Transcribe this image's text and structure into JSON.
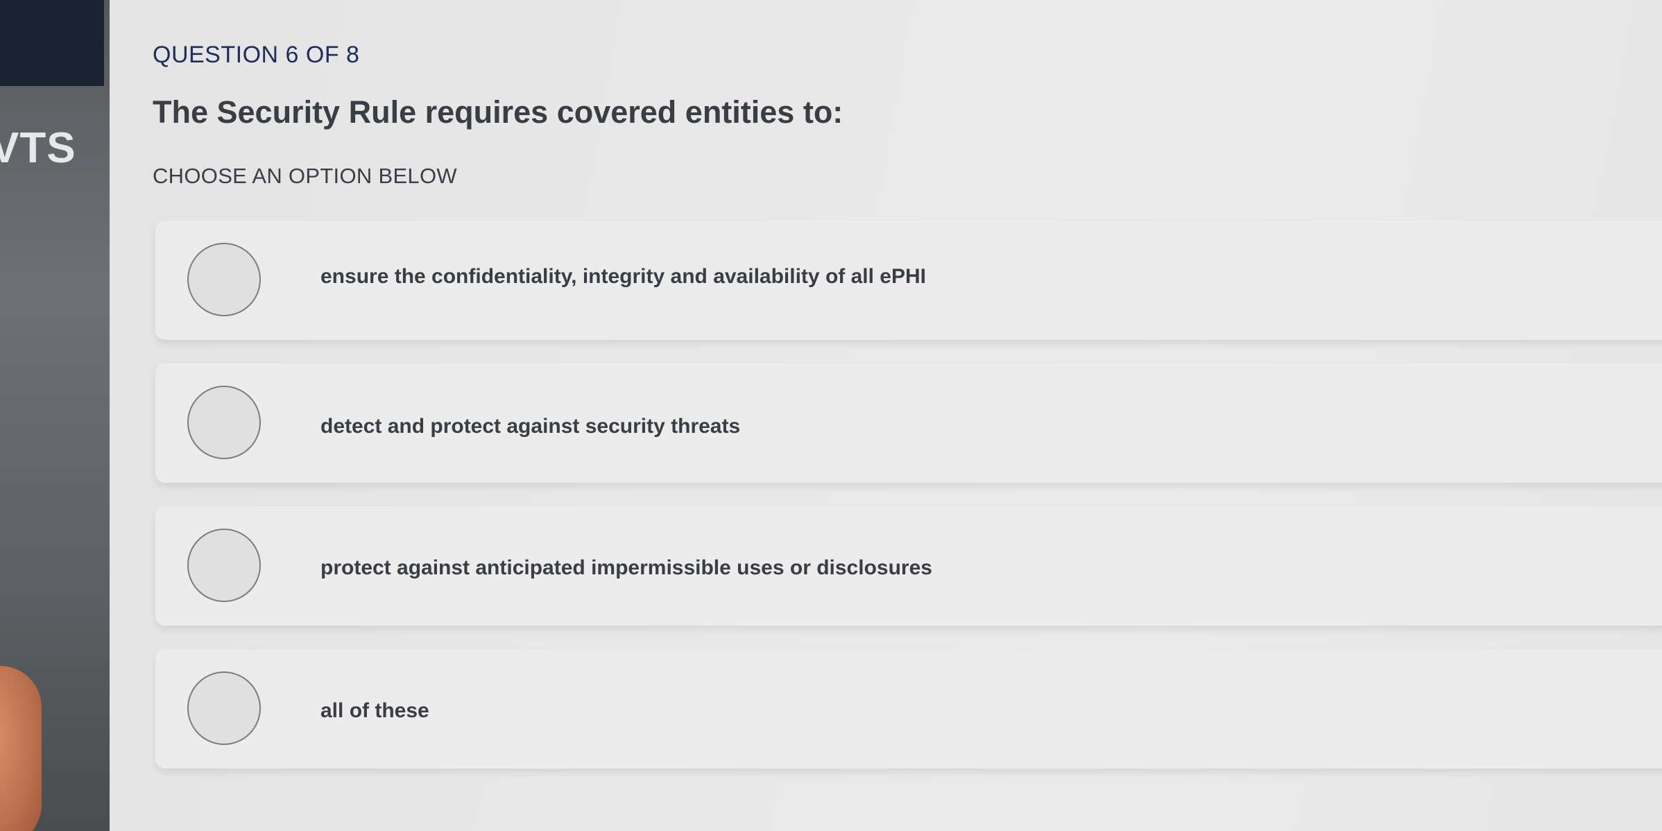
{
  "sidebar": {
    "label": "VTS"
  },
  "quiz": {
    "counter": "QUESTION 6 OF 8",
    "question": "The Security Rule requires covered entities to:",
    "instruction": "CHOOSE AN OPTION BELOW",
    "options": [
      {
        "label": "ensure the confidentiality, integrity and availability of all ePHI",
        "selected": false
      },
      {
        "label": "detect and protect against security threats",
        "selected": false
      },
      {
        "label": "protect against anticipated impermissible uses or disclosures",
        "selected": false
      },
      {
        "label": "all of these",
        "selected": false
      }
    ]
  }
}
